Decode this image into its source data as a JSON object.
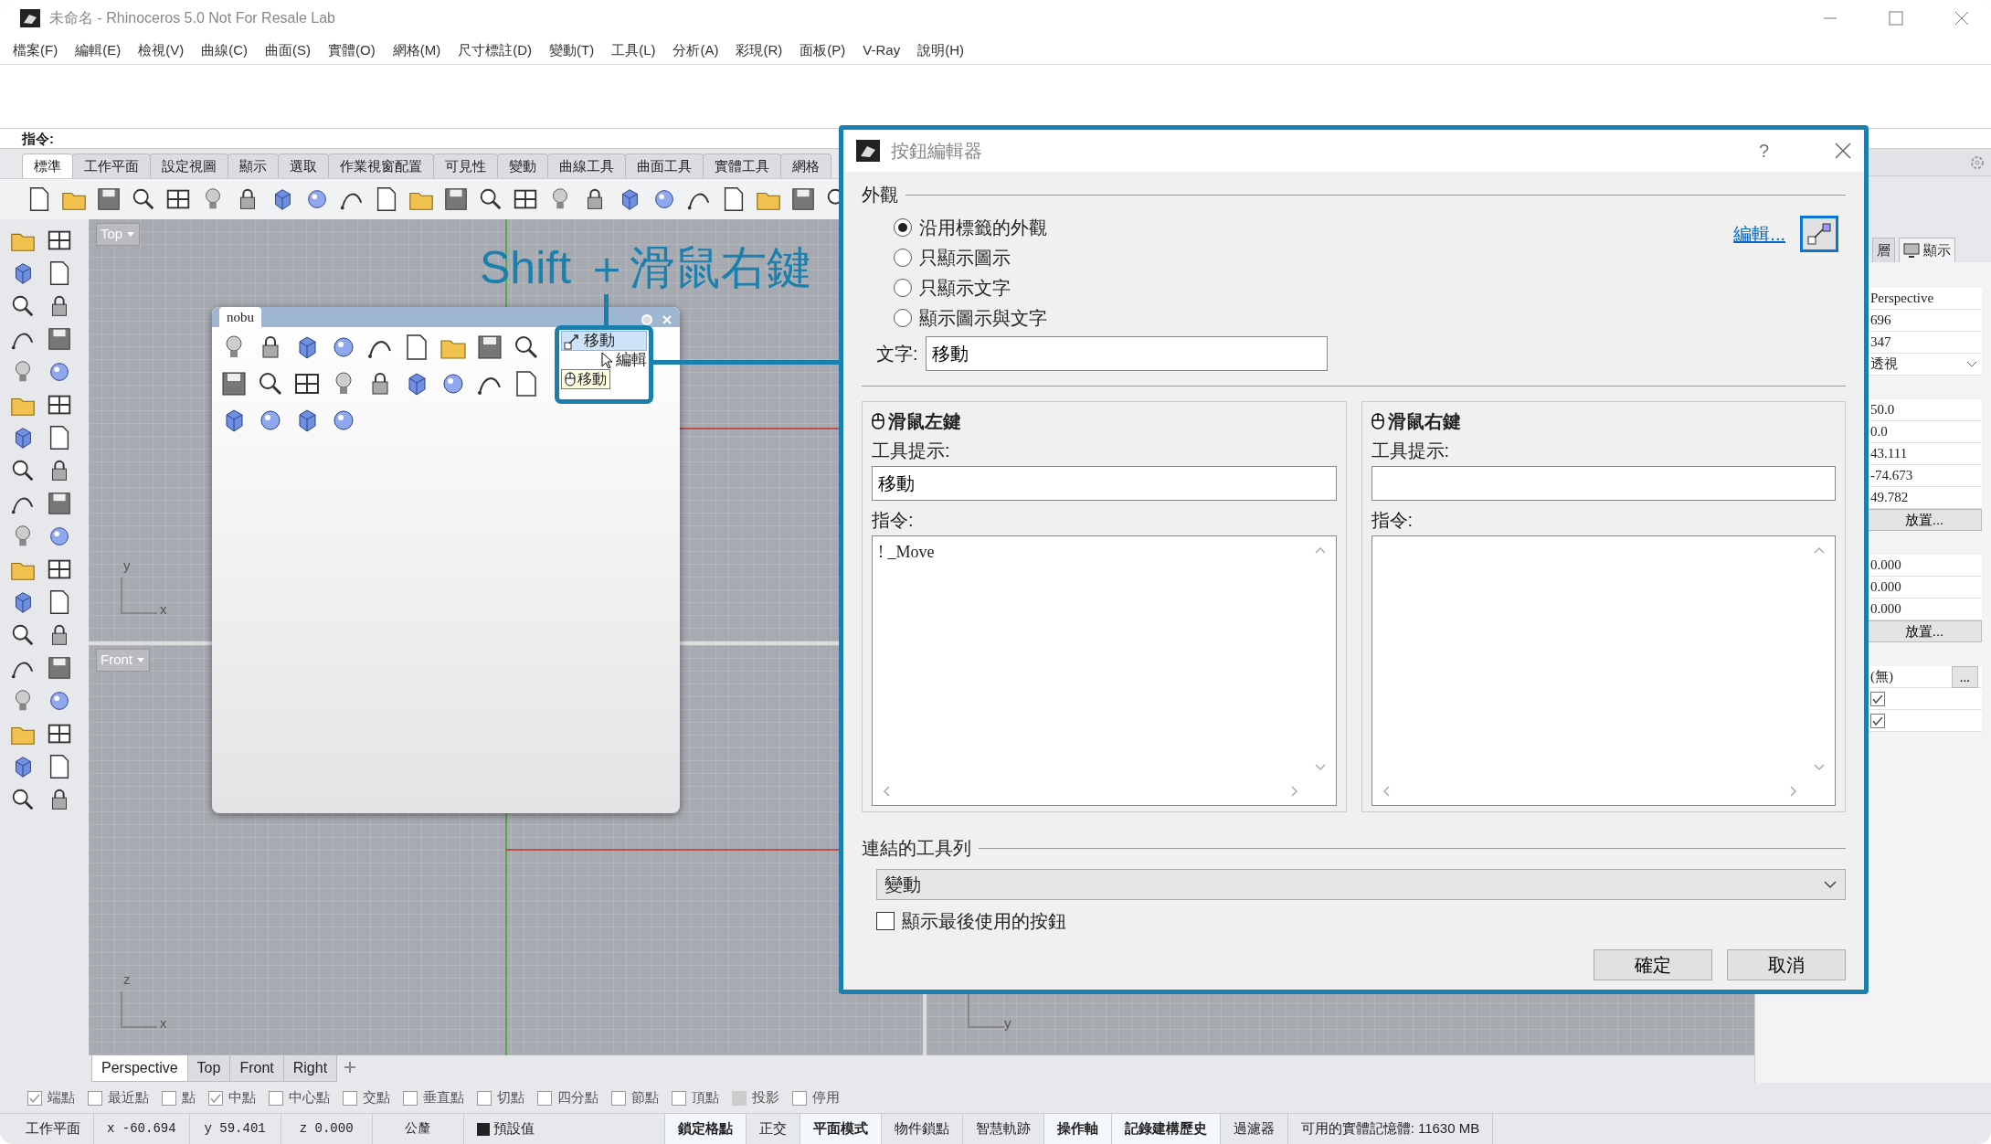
{
  "window": {
    "title": "未命名 - Rhinoceros 5.0 Not For Resale Lab"
  },
  "menu": [
    "檔案(F)",
    "編輯(E)",
    "檢視(V)",
    "曲線(C)",
    "曲面(S)",
    "實體(O)",
    "網格(M)",
    "尺寸標註(D)",
    "變動(T)",
    "工具(L)",
    "分析(A)",
    "彩現(R)",
    "面板(P)",
    "V-Ray",
    "說明(H)"
  ],
  "command": {
    "label": "指令:"
  },
  "toolbar_tabs": [
    {
      "label": "標準",
      "selected": true
    },
    {
      "label": "工作平面",
      "selected": false
    },
    {
      "label": "設定視圖",
      "selected": false
    },
    {
      "label": "顯示",
      "selected": false
    },
    {
      "label": "選取",
      "selected": false
    },
    {
      "label": "作業視窗配置",
      "selected": false
    },
    {
      "label": "可見性",
      "selected": false
    },
    {
      "label": "變動",
      "selected": false
    },
    {
      "label": "曲線工具",
      "selected": false
    },
    {
      "label": "曲面工具",
      "selected": false
    },
    {
      "label": "實體工具",
      "selected": false
    },
    {
      "label": "網格",
      "selected": false
    }
  ],
  "viewports": [
    {
      "label": "Top",
      "axes": [
        "y",
        "x"
      ]
    },
    {
      "label": "Front",
      "axes": [
        "z",
        "x"
      ]
    }
  ],
  "hidden_viewport_axis": "y",
  "annotation": "Shift ＋滑鼠右鍵",
  "floating_toolbar": {
    "tab": "nobu",
    "button_label": "移動",
    "menu_item": "編輯",
    "tooltip": "移動"
  },
  "viewport_tabs": [
    {
      "label": "Perspective",
      "selected": true
    },
    {
      "label": "Top",
      "selected": false
    },
    {
      "label": "Front",
      "selected": false
    },
    {
      "label": "Right",
      "selected": false
    }
  ],
  "osnaps": [
    {
      "label": "端點",
      "checked": true,
      "disabled": false
    },
    {
      "label": "最近點",
      "checked": false,
      "disabled": false
    },
    {
      "label": "點",
      "checked": false,
      "disabled": false
    },
    {
      "label": "中點",
      "checked": true,
      "disabled": false
    },
    {
      "label": "中心點",
      "checked": false,
      "disabled": false
    },
    {
      "label": "交點",
      "checked": false,
      "disabled": false
    },
    {
      "label": "垂直點",
      "checked": false,
      "disabled": false
    },
    {
      "label": "切點",
      "checked": false,
      "disabled": false
    },
    {
      "label": "四分點",
      "checked": false,
      "disabled": false
    },
    {
      "label": "節點",
      "checked": false,
      "disabled": false
    },
    {
      "label": "頂點",
      "checked": false,
      "disabled": false
    },
    {
      "label": "投影",
      "checked": false,
      "disabled": true
    },
    {
      "label": "停用",
      "checked": false,
      "disabled": false
    }
  ],
  "status_bar": [
    {
      "kind": "info",
      "text": "工作平面"
    },
    {
      "kind": "coord",
      "text": "x -60.694"
    },
    {
      "kind": "coord",
      "text": "y 59.401"
    },
    {
      "kind": "coord",
      "text": "z 0.000"
    },
    {
      "kind": "coord",
      "text": "公釐"
    },
    {
      "kind": "layer",
      "text": "預設值"
    },
    {
      "kind": "toggle",
      "text": "鎖定格點",
      "on": true
    },
    {
      "kind": "toggle",
      "text": "正交",
      "on": false
    },
    {
      "kind": "toggle",
      "text": "平面模式",
      "on": true
    },
    {
      "kind": "toggle",
      "text": "物件鎖點",
      "on": false
    },
    {
      "kind": "toggle",
      "text": "智慧軌跡",
      "on": false
    },
    {
      "kind": "toggle",
      "text": "操作軸",
      "on": true
    },
    {
      "kind": "toggle",
      "text": "記錄建構歷史",
      "on": true
    },
    {
      "kind": "toggle",
      "text": "過濾器",
      "on": false
    },
    {
      "kind": "info",
      "text": "可用的實體記憶體: 11630 MB"
    }
  ],
  "panel": {
    "tabs": [
      {
        "label": "層",
        "selected": false
      },
      {
        "label": "顯示",
        "selected": true
      }
    ],
    "rows": [
      {
        "kind": "text",
        "value": "Perspective"
      },
      {
        "kind": "text",
        "value": "696"
      },
      {
        "kind": "text",
        "value": "347"
      },
      {
        "kind": "select",
        "value": "透視"
      },
      {
        "kind": "spacer"
      },
      {
        "kind": "text",
        "value": "50.0"
      },
      {
        "kind": "text",
        "value": "0.0"
      },
      {
        "kind": "text",
        "value": "43.111"
      },
      {
        "kind": "text",
        "value": "-74.673"
      },
      {
        "kind": "text",
        "value": "49.782"
      },
      {
        "kind": "button",
        "value": "放置..."
      },
      {
        "kind": "spacer"
      },
      {
        "kind": "text",
        "value": "0.000"
      },
      {
        "kind": "text",
        "value": "0.000"
      },
      {
        "kind": "text",
        "value": "0.000"
      },
      {
        "kind": "button",
        "value": "放置..."
      },
      {
        "kind": "spacer"
      },
      {
        "kind": "browse",
        "value": "(無)",
        "button": "..."
      },
      {
        "kind": "check",
        "checked": true
      },
      {
        "kind": "check",
        "checked": true
      }
    ]
  },
  "dialog": {
    "title": "按鈕編輯器",
    "help": "?",
    "appearance": {
      "heading": "外觀",
      "options": [
        {
          "label": "沿用標籤的外觀",
          "selected": true
        },
        {
          "label": "只顯示圖示",
          "selected": false
        },
        {
          "label": "只顯示文字",
          "selected": false
        },
        {
          "label": "顯示圖示與文字",
          "selected": false
        }
      ],
      "edit_link": "編輯...",
      "text_label": "文字:",
      "text_value": "移動"
    },
    "mouse": [
      {
        "heading": "滑鼠左鍵",
        "tooltip_label": "工具提示:",
        "tooltip_value": "移動",
        "command_label": "指令:",
        "command_value": "! _Move"
      },
      {
        "heading": "滑鼠右鍵",
        "tooltip_label": "工具提示:",
        "command_label": "指令:"
      }
    ],
    "linked_toolbar": {
      "heading": "連結的工具列",
      "value": "變動"
    },
    "show_last": {
      "label": "顯示最後使用的按鈕",
      "checked": false
    },
    "buttons": [
      "確定",
      "取消"
    ]
  }
}
